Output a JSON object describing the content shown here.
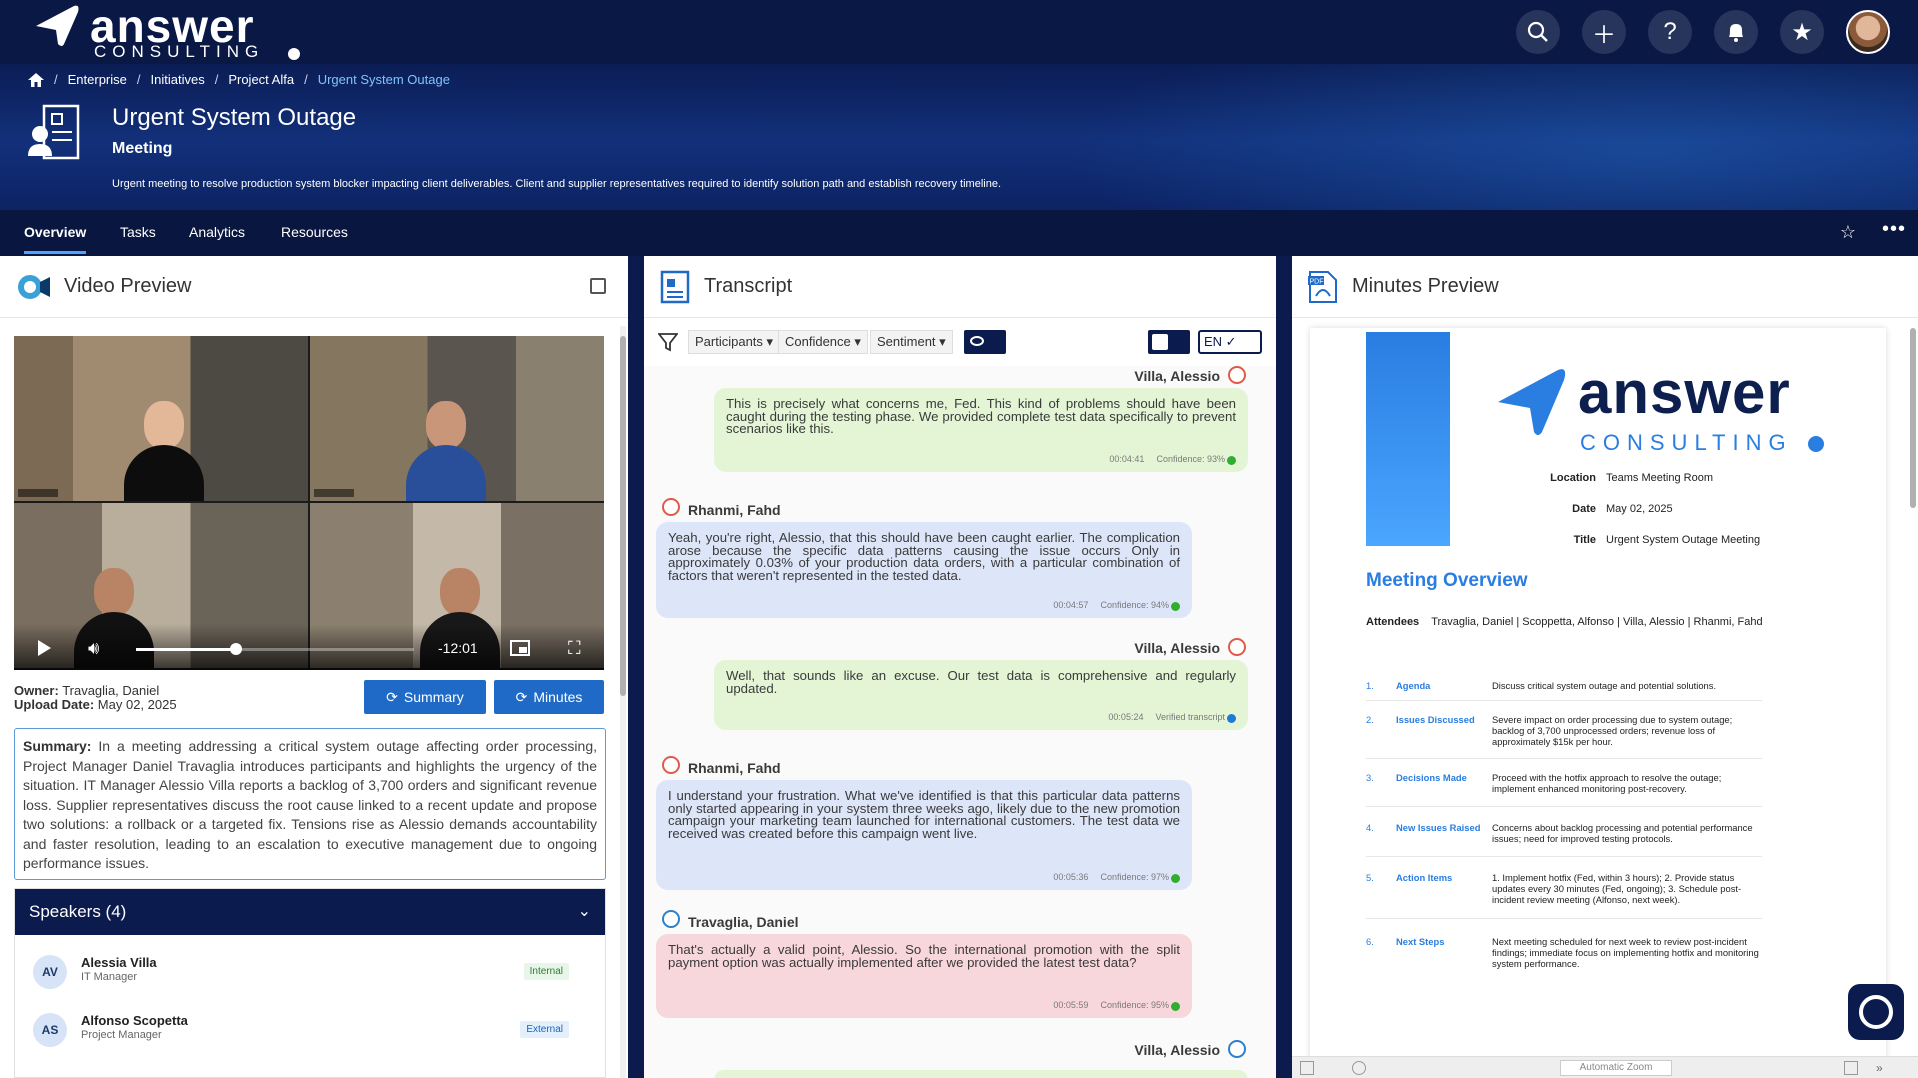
{
  "brand": {
    "name": "answer",
    "tagline": "CONSULTING"
  },
  "top_actions": [
    "search-icon",
    "plus-icon",
    "help-icon",
    "bell-icon",
    "star-icon",
    "avatar"
  ],
  "breadcrumb": [
    "Enterprise",
    "Initiatives",
    "Project Alfa",
    "Urgent System Outage"
  ],
  "page": {
    "title": "Urgent System Outage",
    "type": "Meeting",
    "description": "Urgent meeting to resolve production system blocker impacting client deliverables. Client and supplier representatives required to identify solution path and establish recovery timeline."
  },
  "tabs": [
    "Overview",
    "Tasks",
    "Analytics",
    "Resources"
  ],
  "video": {
    "title": "Video Preview",
    "time": "-12:01",
    "progress": 0.36,
    "owner_label": "Owner:",
    "owner": "Travaglia, Daniel",
    "upload_label": "Upload Date:",
    "upload_date": "May 02, 2025",
    "summary_btn": "Summary",
    "minutes_btn": "Minutes",
    "summary_label": "Summary:",
    "summary": "In a meeting addressing a critical system outage affecting order processing, Project Manager Daniel Travaglia introduces participants and highlights the urgency of the situation. IT Manager Alessio Villa reports a backlog of 3,700 orders and significant revenue loss. Supplier representatives discuss the root cause linked to a recent update and propose two solutions: a rollback or a targeted fix. Tensions rise as Alessio demands accountability and faster resolution, leading to an escalation to executive management due to ongoing performance issues."
  },
  "speakers": {
    "title": "Speakers (4)",
    "items": [
      {
        "initials": "AV",
        "name": "Alessia Villa",
        "role": "IT Manager",
        "tag": "Internal"
      },
      {
        "initials": "AS",
        "name": "Alfonso Scopetta",
        "role": "Project Manager",
        "tag": "External"
      }
    ]
  },
  "transcript": {
    "title": "Transcript",
    "filters": [
      "Participants ▾",
      "Confidence ▾",
      "Sentiment ▾"
    ],
    "language": "EN ✓",
    "messages": [
      {
        "speaker": "Villa, Alessio",
        "side": "right",
        "color": "green",
        "text": "This is precisely what concerns me, Fed. This kind of problems should have been caught during the testing phase. We provided complete test data specifically to prevent scenarios like this.",
        "time": "00:04:41",
        "conf": "Confidence: 93%"
      },
      {
        "speaker": "Rhanmi, Fahd",
        "side": "left",
        "color": "blue",
        "text": "Yeah, you're right, Alessio, that this should have been caught earlier. The complication arose because the specific data patterns causing the issue occurs Only in approximately 0.03% of your production data orders, with a particular combination of factors that weren't represented in the tested data.",
        "time": "00:04:57",
        "conf": "Confidence: 94%"
      },
      {
        "speaker": "Villa, Alessio",
        "side": "right",
        "color": "green",
        "text": "Well, that sounds like an excuse. Our test data is comprehensive and regularly updated.",
        "time": "00:05:24",
        "conf": "Verified transcript"
      },
      {
        "speaker": "Rhanmi, Fahd",
        "side": "left",
        "color": "blue",
        "text": "I understand your frustration. What we've identified is that this particular data patterns only started appearing in your system three weeks ago, likely due to the new promotion campaign your marketing team launched for international customers. The test data we received was created before this campaign went live.",
        "time": "00:05:36",
        "conf": "Confidence: 97%"
      },
      {
        "speaker": "Travaglia, Daniel",
        "side": "left",
        "color": "pink",
        "text": "That's actually a valid point, Alessio. So the international promotion with the split payment option was actually implemented after we provided the latest test data?",
        "time": "00:05:59",
        "conf": "Confidence: 95%"
      },
      {
        "speaker": "Villa, Alessio",
        "side": "right",
        "color": "green",
        "text": "",
        "time": "",
        "conf": ""
      }
    ]
  },
  "minutes": {
    "title": "Minutes Preview",
    "doc_brand": "answer",
    "doc_tagline": "CONSULTING",
    "info": [
      {
        "k": "Location",
        "v": "Teams Meeting Room"
      },
      {
        "k": "Date",
        "v": "May 02, 2025"
      },
      {
        "k": "Title",
        "v": "Urgent System Outage Meeting"
      }
    ],
    "heading": "Meeting Overview",
    "attendees_label": "Attendees",
    "attendees": "Travaglia, Daniel | Scoppetta, Alfonso | Villa, Alessio | Rhanmi, Fahd",
    "items": [
      {
        "n": "1.",
        "label": "Agenda",
        "text": "Discuss critical system outage and potential solutions."
      },
      {
        "n": "2.",
        "label": "Issues Discussed",
        "text": "Severe impact on order processing due to system outage; backlog of 3,700 unprocessed orders; revenue loss of approximately $15k per hour."
      },
      {
        "n": "3.",
        "label": "Decisions Made",
        "text": "Proceed with the hotfix approach to resolve the outage; implement enhanced monitoring post-recovery."
      },
      {
        "n": "4.",
        "label": "New Issues Raised",
        "text": "Concerns about backlog processing and potential performance issues; need for improved testing protocols."
      },
      {
        "n": "5.",
        "label": "Action Items",
        "text": "1. Implement hotfix (Fed, within 3 hours); 2. Provide status updates every 30 minutes (Fed, ongoing); 3. Schedule post-incident review meeting (Alfonso, next week)."
      },
      {
        "n": "6.",
        "label": "Next Steps",
        "text": "Next meeting scheduled for next week to review post-incident findings; immediate focus on implementing hotfix and monitoring system performance."
      }
    ],
    "zoom": "Automatic Zoom"
  },
  "colors": {
    "navy": "#0b1b4d",
    "accent": "#1f6ac7",
    "link": "#7fc4ff"
  }
}
